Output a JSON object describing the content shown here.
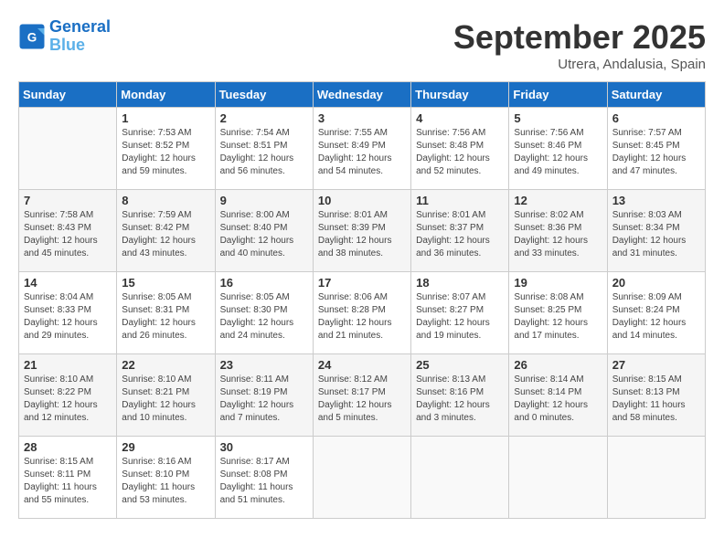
{
  "header": {
    "logo_line1": "General",
    "logo_line2": "Blue",
    "month": "September 2025",
    "location": "Utrera, Andalusia, Spain"
  },
  "days_of_week": [
    "Sunday",
    "Monday",
    "Tuesday",
    "Wednesday",
    "Thursday",
    "Friday",
    "Saturday"
  ],
  "weeks": [
    [
      {
        "day": "",
        "info": ""
      },
      {
        "day": "1",
        "info": "Sunrise: 7:53 AM\nSunset: 8:52 PM\nDaylight: 12 hours\nand 59 minutes."
      },
      {
        "day": "2",
        "info": "Sunrise: 7:54 AM\nSunset: 8:51 PM\nDaylight: 12 hours\nand 56 minutes."
      },
      {
        "day": "3",
        "info": "Sunrise: 7:55 AM\nSunset: 8:49 PM\nDaylight: 12 hours\nand 54 minutes."
      },
      {
        "day": "4",
        "info": "Sunrise: 7:56 AM\nSunset: 8:48 PM\nDaylight: 12 hours\nand 52 minutes."
      },
      {
        "day": "5",
        "info": "Sunrise: 7:56 AM\nSunset: 8:46 PM\nDaylight: 12 hours\nand 49 minutes."
      },
      {
        "day": "6",
        "info": "Sunrise: 7:57 AM\nSunset: 8:45 PM\nDaylight: 12 hours\nand 47 minutes."
      }
    ],
    [
      {
        "day": "7",
        "info": "Sunrise: 7:58 AM\nSunset: 8:43 PM\nDaylight: 12 hours\nand 45 minutes."
      },
      {
        "day": "8",
        "info": "Sunrise: 7:59 AM\nSunset: 8:42 PM\nDaylight: 12 hours\nand 43 minutes."
      },
      {
        "day": "9",
        "info": "Sunrise: 8:00 AM\nSunset: 8:40 PM\nDaylight: 12 hours\nand 40 minutes."
      },
      {
        "day": "10",
        "info": "Sunrise: 8:01 AM\nSunset: 8:39 PM\nDaylight: 12 hours\nand 38 minutes."
      },
      {
        "day": "11",
        "info": "Sunrise: 8:01 AM\nSunset: 8:37 PM\nDaylight: 12 hours\nand 36 minutes."
      },
      {
        "day": "12",
        "info": "Sunrise: 8:02 AM\nSunset: 8:36 PM\nDaylight: 12 hours\nand 33 minutes."
      },
      {
        "day": "13",
        "info": "Sunrise: 8:03 AM\nSunset: 8:34 PM\nDaylight: 12 hours\nand 31 minutes."
      }
    ],
    [
      {
        "day": "14",
        "info": "Sunrise: 8:04 AM\nSunset: 8:33 PM\nDaylight: 12 hours\nand 29 minutes."
      },
      {
        "day": "15",
        "info": "Sunrise: 8:05 AM\nSunset: 8:31 PM\nDaylight: 12 hours\nand 26 minutes."
      },
      {
        "day": "16",
        "info": "Sunrise: 8:05 AM\nSunset: 8:30 PM\nDaylight: 12 hours\nand 24 minutes."
      },
      {
        "day": "17",
        "info": "Sunrise: 8:06 AM\nSunset: 8:28 PM\nDaylight: 12 hours\nand 21 minutes."
      },
      {
        "day": "18",
        "info": "Sunrise: 8:07 AM\nSunset: 8:27 PM\nDaylight: 12 hours\nand 19 minutes."
      },
      {
        "day": "19",
        "info": "Sunrise: 8:08 AM\nSunset: 8:25 PM\nDaylight: 12 hours\nand 17 minutes."
      },
      {
        "day": "20",
        "info": "Sunrise: 8:09 AM\nSunset: 8:24 PM\nDaylight: 12 hours\nand 14 minutes."
      }
    ],
    [
      {
        "day": "21",
        "info": "Sunrise: 8:10 AM\nSunset: 8:22 PM\nDaylight: 12 hours\nand 12 minutes."
      },
      {
        "day": "22",
        "info": "Sunrise: 8:10 AM\nSunset: 8:21 PM\nDaylight: 12 hours\nand 10 minutes."
      },
      {
        "day": "23",
        "info": "Sunrise: 8:11 AM\nSunset: 8:19 PM\nDaylight: 12 hours\nand 7 minutes."
      },
      {
        "day": "24",
        "info": "Sunrise: 8:12 AM\nSunset: 8:17 PM\nDaylight: 12 hours\nand 5 minutes."
      },
      {
        "day": "25",
        "info": "Sunrise: 8:13 AM\nSunset: 8:16 PM\nDaylight: 12 hours\nand 3 minutes."
      },
      {
        "day": "26",
        "info": "Sunrise: 8:14 AM\nSunset: 8:14 PM\nDaylight: 12 hours\nand 0 minutes."
      },
      {
        "day": "27",
        "info": "Sunrise: 8:15 AM\nSunset: 8:13 PM\nDaylight: 11 hours\nand 58 minutes."
      }
    ],
    [
      {
        "day": "28",
        "info": "Sunrise: 8:15 AM\nSunset: 8:11 PM\nDaylight: 11 hours\nand 55 minutes."
      },
      {
        "day": "29",
        "info": "Sunrise: 8:16 AM\nSunset: 8:10 PM\nDaylight: 11 hours\nand 53 minutes."
      },
      {
        "day": "30",
        "info": "Sunrise: 8:17 AM\nSunset: 8:08 PM\nDaylight: 11 hours\nand 51 minutes."
      },
      {
        "day": "",
        "info": ""
      },
      {
        "day": "",
        "info": ""
      },
      {
        "day": "",
        "info": ""
      },
      {
        "day": "",
        "info": ""
      }
    ]
  ]
}
